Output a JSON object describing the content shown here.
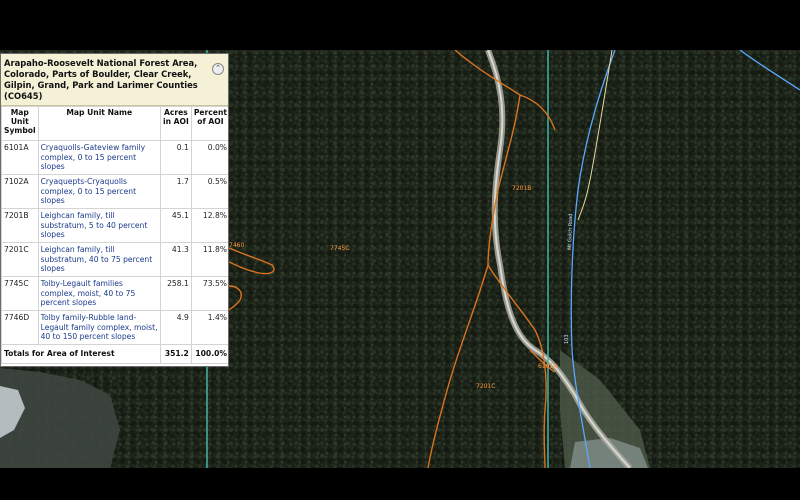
{
  "panel": {
    "title": "Arapaho-Roosevelt National Forest Area, Colorado, Parts of Boulder, Clear Creek, Gilpin, Grand, Park and Larimer Counties (CO645)",
    "collapse_icon": "chevron-up-icon",
    "collapse_glyph": "⌃",
    "columns": [
      "Map Unit Symbol",
      "Map Unit Name",
      "Acres in AOI",
      "Percent of AOI"
    ],
    "rows": [
      {
        "symbol": "6101A",
        "name": "Cryaquolls-Gateview family complex, 0 to 15 percent slopes",
        "acres": "0.1",
        "percent": "0.0%"
      },
      {
        "symbol": "7102A",
        "name": "Cryaquepts-Cryaquolls complex, 0 to 15 percent slopes",
        "acres": "1.7",
        "percent": "0.5%"
      },
      {
        "symbol": "7201B",
        "name": "Leighcan family, till substratum, 5 to 40 percent slopes",
        "acres": "45.1",
        "percent": "12.8%"
      },
      {
        "symbol": "7201C",
        "name": "Leighcan family, till substratum, 40 to 75 percent slopes",
        "acres": "41.3",
        "percent": "11.8%"
      },
      {
        "symbol": "7745C",
        "name": "Tolby-Legault families complex, moist, 40 to 75 percent slopes",
        "acres": "258.1",
        "percent": "73.5%"
      },
      {
        "symbol": "7746D",
        "name": "Tolby family-Rubble land-Legault family complex, moist, 40 to 150 percent slopes",
        "acres": "4.9",
        "percent": "1.4%"
      }
    ],
    "totals": {
      "label": "Totals for Area of Interest",
      "acres": "351.2",
      "percent": "100.0%"
    }
  },
  "map": {
    "unit_labels": [
      "7201B",
      "7745C",
      "7460",
      "6101A",
      "7201C"
    ],
    "road_label": "103",
    "road_label_vertical": "Mt Gulch Road",
    "colors": {
      "soil_boundary": "#d9731f",
      "aoi_boundary": "#3fb8a8",
      "stream": "#5aa9ff",
      "road": "#cfcfcf",
      "forest": "#1c2318"
    }
  }
}
